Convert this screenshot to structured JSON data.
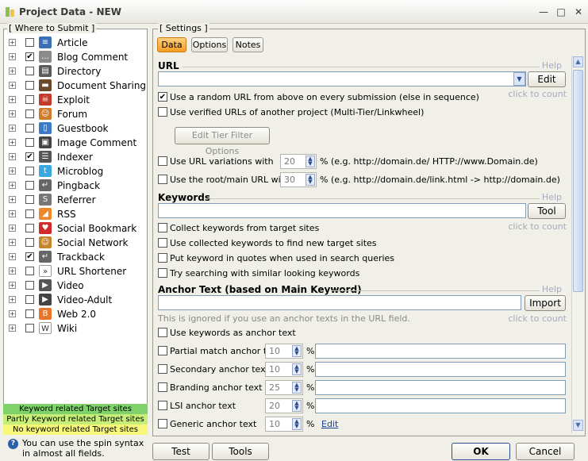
{
  "window": {
    "title": "Project Data - NEW",
    "minimize": "—",
    "maximize": "□",
    "close": "✕"
  },
  "where_to_submit": {
    "caption": "[ Where to Submit ]",
    "items": [
      {
        "label": "Article",
        "checked": false,
        "icon": "article-icon",
        "color": "#3b6fb6",
        "glyph": "≡"
      },
      {
        "label": "Blog Comment",
        "checked": true,
        "icon": "blog-comment-icon",
        "color": "#8a8a8a",
        "glyph": "…"
      },
      {
        "label": "Directory",
        "checked": false,
        "icon": "directory-icon",
        "color": "#5a5a5a",
        "glyph": "▤"
      },
      {
        "label": "Document Sharing",
        "checked": false,
        "icon": "document-sharing-icon",
        "color": "#6a4a2a",
        "glyph": "▬"
      },
      {
        "label": "Exploit",
        "checked": false,
        "icon": "exploit-icon",
        "color": "#c43a2a",
        "glyph": "☠"
      },
      {
        "label": "Forum",
        "checked": false,
        "icon": "forum-icon",
        "color": "#d07a2a",
        "glyph": "☺"
      },
      {
        "label": "Guestbook",
        "checked": false,
        "icon": "guestbook-icon",
        "color": "#3a7ac8",
        "glyph": "▯"
      },
      {
        "label": "Image Comment",
        "checked": false,
        "icon": "image-comment-icon",
        "color": "#444",
        "glyph": "▣"
      },
      {
        "label": "Indexer",
        "checked": true,
        "icon": "indexer-icon",
        "color": "#555",
        "glyph": "☰"
      },
      {
        "label": "Microblog",
        "checked": false,
        "icon": "microblog-icon",
        "color": "#3aa8e0",
        "glyph": "t"
      },
      {
        "label": "Pingback",
        "checked": false,
        "icon": "pingback-icon",
        "color": "#666",
        "glyph": "↵"
      },
      {
        "label": "Referrer",
        "checked": false,
        "icon": "referrer-icon",
        "color": "#777",
        "glyph": "S"
      },
      {
        "label": "RSS",
        "checked": false,
        "icon": "rss-icon",
        "color": "#f0882a",
        "glyph": "◢"
      },
      {
        "label": "Social Bookmark",
        "checked": false,
        "icon": "social-bookmark-icon",
        "color": "#d02a2a",
        "glyph": "♥"
      },
      {
        "label": "Social Network",
        "checked": false,
        "icon": "social-network-icon",
        "color": "#c8842a",
        "glyph": "☺"
      },
      {
        "label": "Trackback",
        "checked": true,
        "icon": "trackback-icon",
        "color": "#666",
        "glyph": "↵"
      },
      {
        "label": "URL Shortener",
        "checked": false,
        "icon": "url-shortener-icon",
        "color": "#fff",
        "glyph": "»"
      },
      {
        "label": "Video",
        "checked": false,
        "icon": "video-icon",
        "color": "#555",
        "glyph": "▶"
      },
      {
        "label": "Video-Adult",
        "checked": false,
        "icon": "video-adult-icon",
        "color": "#444",
        "glyph": "▶"
      },
      {
        "label": "Web 2.0",
        "checked": false,
        "icon": "web20-icon",
        "color": "#e8762a",
        "glyph": "B"
      },
      {
        "label": "Wiki",
        "checked": false,
        "icon": "wiki-icon",
        "color": "#fff",
        "glyph": "W"
      }
    ],
    "legend": [
      {
        "label": "Keyword related Target sites",
        "color": "#7fd16a"
      },
      {
        "label": "Partly Keyword related Target sites",
        "color": "#c8ee7a"
      },
      {
        "label": "No keyword related Target sites",
        "color": "#f7f77a"
      }
    ]
  },
  "hint": "You can use the spin syntax in almost all fields.",
  "settings": {
    "caption": "[ Settings ]",
    "tabs": [
      "Data",
      "Options",
      "Notes"
    ],
    "url": {
      "title": "URL",
      "help": "Help",
      "edit": "Edit",
      "value": "",
      "click_to_count": "click to count",
      "random_url": {
        "label": "Use a random URL from above on every submission (else in sequence)",
        "checked": true
      },
      "verified": {
        "label": "Use verified URLs of another project (Multi-Tier/Linkwheel)",
        "checked": false
      },
      "tier_filter": "Edit Tier Filter Options",
      "variations": {
        "label": "Use URL variations with",
        "value": "20",
        "suffix": "% (e.g. http://domain.de/ HTTP://www.Domain.de)",
        "checked": false
      },
      "root": {
        "label": "Use the root/main URL with",
        "value": "30",
        "suffix": "% (e.g. http://domain.de/link.html -> http://domain.de)",
        "checked": false
      }
    },
    "keywords": {
      "title": "Keywords",
      "help": "Help",
      "tool": "Tool",
      "value": "",
      "click_to_count": "click to count",
      "options": [
        {
          "label": "Collect keywords from target sites",
          "checked": false
        },
        {
          "label": "Use collected keywords to find new target sites",
          "checked": false
        },
        {
          "label": "Put keyword in quotes when used in search queries",
          "checked": false
        },
        {
          "label": "Try searching with similar looking keywords",
          "checked": false
        }
      ]
    },
    "anchor": {
      "title": "Anchor Text (based on Main Keyword)",
      "help": "Help",
      "import": "Import",
      "value": "",
      "note": "This is ignored if you use an anchor texts in the URL field.",
      "click_to_count": "click to count",
      "use_keywords": {
        "label": "Use keywords as anchor text",
        "checked": false
      },
      "rows": [
        {
          "label": "Partial match anchor text",
          "value": "10",
          "checked": false
        },
        {
          "label": "Secondary anchor text",
          "value": "10",
          "checked": false
        },
        {
          "label": "Branding anchor text",
          "value": "25",
          "checked": false
        },
        {
          "label": "LSI anchor text",
          "value": "20",
          "checked": false
        },
        {
          "label": "Generic anchor text",
          "value": "10",
          "checked": false
        }
      ],
      "percent": "%",
      "edit_link": "Edit"
    }
  },
  "footer": {
    "test": "Test",
    "tools": "Tools",
    "ok": "OK",
    "cancel": "Cancel"
  }
}
